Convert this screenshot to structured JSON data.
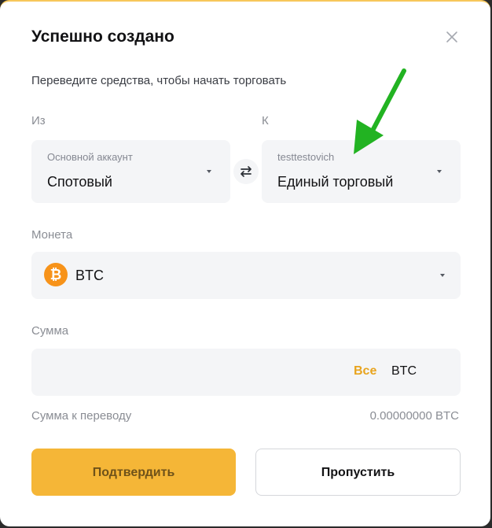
{
  "dialog": {
    "title": "Успешно создано",
    "subtitle": "Переведите средства, чтобы начать торговать"
  },
  "from": {
    "label": "Из",
    "account_caption": "Основной аккаунт",
    "account_value": "Спотовый"
  },
  "to": {
    "label": "К",
    "account_caption": "testtestovich",
    "account_value": "Единый торговый"
  },
  "coin": {
    "label": "Монета",
    "icon_symbol": "₿",
    "value": "BTC",
    "icon_color": "#f7931a"
  },
  "amount": {
    "label": "Сумма",
    "value": "",
    "all_label": "Все",
    "currency": "BTC"
  },
  "transfer": {
    "label": "Сумма к переводу",
    "value": "0.00000000 BTC"
  },
  "buttons": {
    "confirm": "Подтвердить",
    "skip": "Пропустить"
  },
  "colors": {
    "accent": "#f5b637",
    "annotation_arrow": "#22b322"
  }
}
